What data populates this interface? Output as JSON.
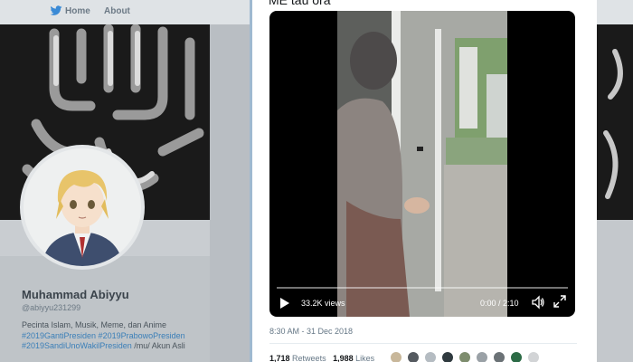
{
  "nav": {
    "home": "Home",
    "about": "About"
  },
  "profile": {
    "name": "Muhammad Abiyyu",
    "handle": "@abiyyu231299",
    "bio_line1": "Pecinta Islam, Musik, Meme, dan Anime",
    "bio_tags1": "#2019GantiPresiden #2019PrabowoPresiden",
    "bio_tags2": "#2019SandiUnoWakilPresiden",
    "bio_tail": " /mu/ Akun Asli"
  },
  "tweet": {
    "title": "ME tau ora",
    "video": {
      "views": "33.2K views",
      "time": "0:00 / 2:10"
    },
    "timestamp": "8:30 AM - 31 Dec 2018",
    "retweets_count": "1,718",
    "retweets_label": "Retweets",
    "likes_count": "1,988",
    "likes_label": "Likes"
  },
  "colors": {
    "link": "#3b7fb8",
    "card_border": "#9fb9d0",
    "video_bg": "#000000"
  },
  "icons": {
    "nav": "twitter-bird-icon",
    "play": "play-icon",
    "volume": "volume-icon",
    "fullscreen": "fullscreen-icon"
  }
}
